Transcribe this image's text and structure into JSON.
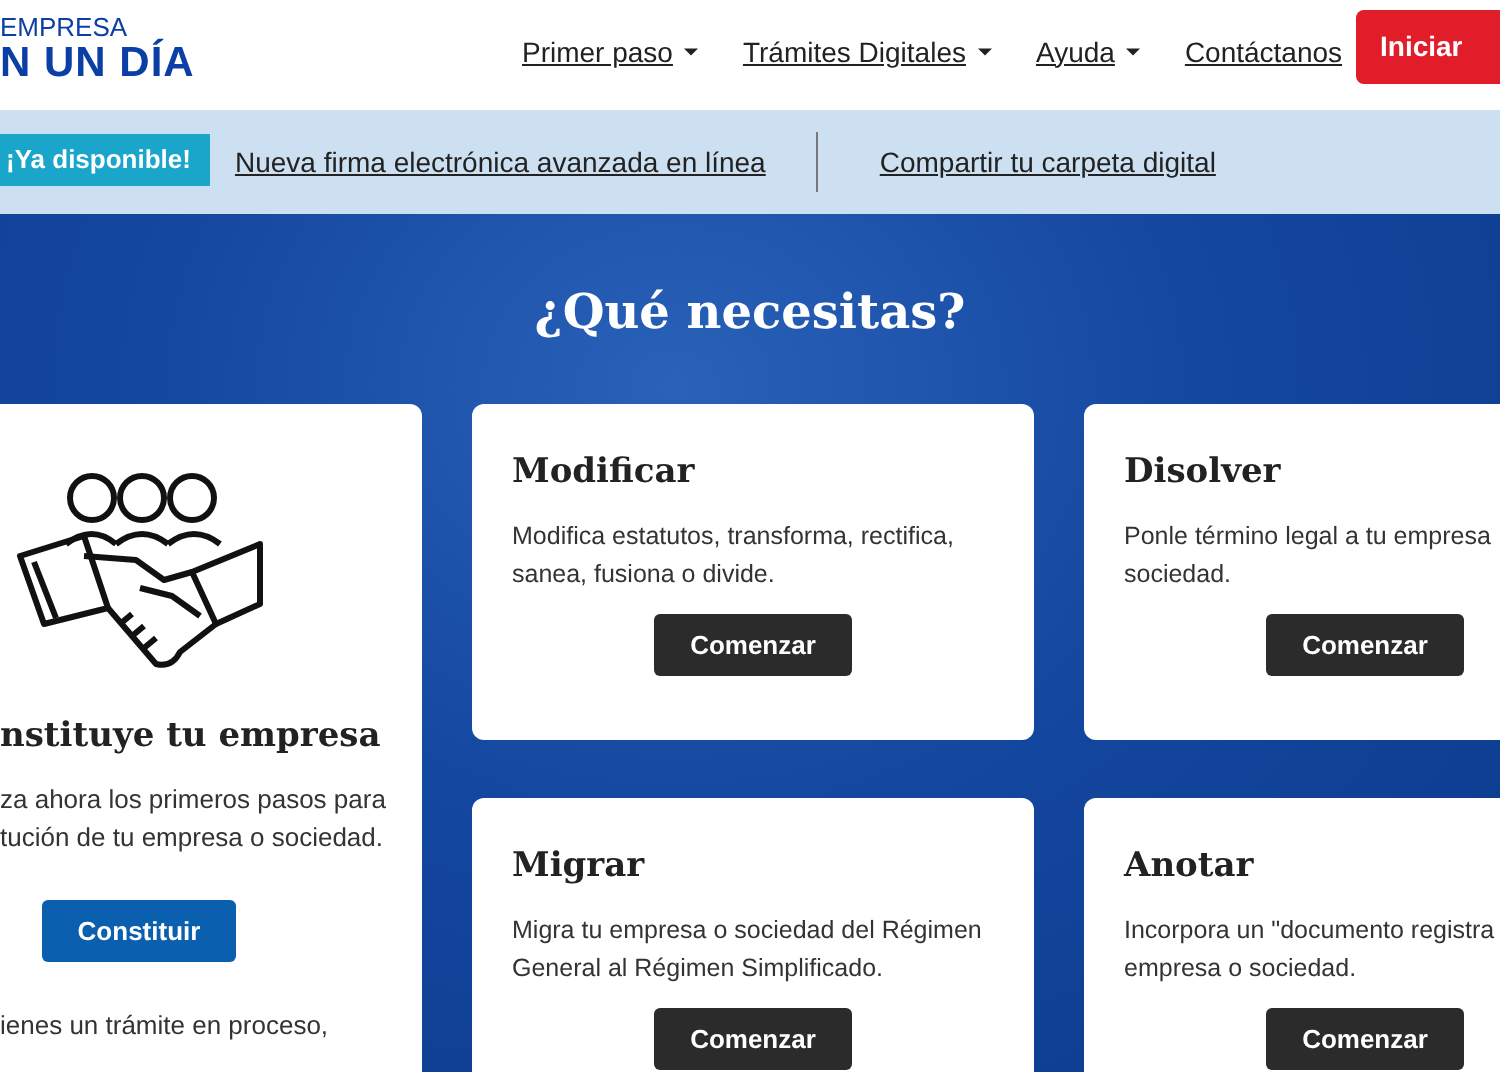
{
  "header": {
    "logo": {
      "line_1": "EMPRESA",
      "line_2": "N UN DÍA"
    },
    "nav": [
      {
        "label": "Primer paso",
        "dropdown": true
      },
      {
        "label": "Trámites Digitales",
        "dropdown": true
      },
      {
        "label": "Ayuda",
        "dropdown": true
      },
      {
        "label": "Contáctanos",
        "dropdown": false
      }
    ],
    "login_button": "Iniciar"
  },
  "announcement": {
    "badge": "¡Ya disponible!",
    "links": [
      "Nueva firma electrónica avanzada en línea",
      "Compartir tu carpeta digital"
    ]
  },
  "hero": {
    "title": "¿Qué necesitas?"
  },
  "featured_card": {
    "title": "nstituye tu empresa",
    "lines": [
      "za ahora los primeros pasos para",
      "tución de tu empresa o sociedad."
    ],
    "button": "Constituir",
    "footer_text": "ienes un trámite en proceso,"
  },
  "cards": [
    {
      "title": "Modificar",
      "lines": [
        "Modifica estatutos, transforma, rectifica,",
        "sanea, fusiona o divide."
      ],
      "button": "Comenzar"
    },
    {
      "title": "Disolver",
      "lines": [
        "Ponle término legal a tu empresa",
        "sociedad."
      ],
      "button": "Comenzar"
    },
    {
      "title": "Migrar",
      "lines": [
        "Migra tu empresa o sociedad del Régimen",
        "General al Régimen Simplificado."
      ],
      "button": "Comenzar"
    },
    {
      "title": "Anotar",
      "lines": [
        "Incorpora un \"documento registra",
        "empresa o sociedad."
      ],
      "button": "Comenzar"
    }
  ]
}
